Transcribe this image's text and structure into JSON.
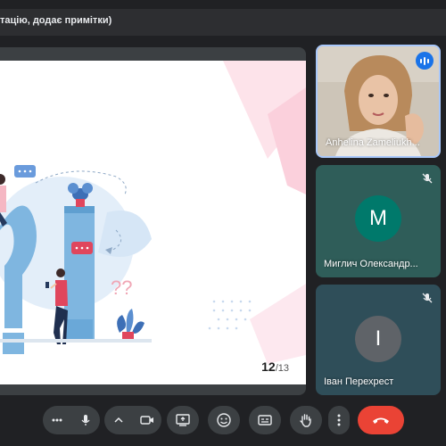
{
  "header": {
    "title": "тацію, додає примітки)"
  },
  "slide": {
    "current_page": "12",
    "total_pages": "/13",
    "decor_text": "??"
  },
  "participants": [
    {
      "name": "Anhelina Zameliukh...",
      "video": true,
      "speaking": true
    },
    {
      "name": "Миглич Олександр...",
      "initial": "M",
      "muted": true
    },
    {
      "name": "Іван Перехрест",
      "initial": "І",
      "muted": true
    }
  ],
  "controls": [
    {
      "id": "more-audio",
      "icon": "more-horizontal-icon"
    },
    {
      "id": "mic",
      "icon": "microphone-icon"
    },
    {
      "id": "camera-options",
      "icon": "chevron-up-icon"
    },
    {
      "id": "camera",
      "icon": "videocam-icon"
    },
    {
      "id": "present",
      "icon": "present-screen-icon"
    },
    {
      "id": "reactions",
      "icon": "emoji-icon"
    },
    {
      "id": "captions",
      "icon": "closed-captions-icon"
    },
    {
      "id": "raise-hand",
      "icon": "hand-icon"
    },
    {
      "id": "more-options",
      "icon": "more-vertical-icon"
    },
    {
      "id": "leave-call",
      "icon": "phone-hangup-icon"
    }
  ],
  "colors": {
    "background": "#202124",
    "control": "#3c4043",
    "end_call": "#ea4335",
    "tile_m": "#2f5d59",
    "tile_i": "#2f4e59",
    "active_border": "#a8c7fa"
  }
}
